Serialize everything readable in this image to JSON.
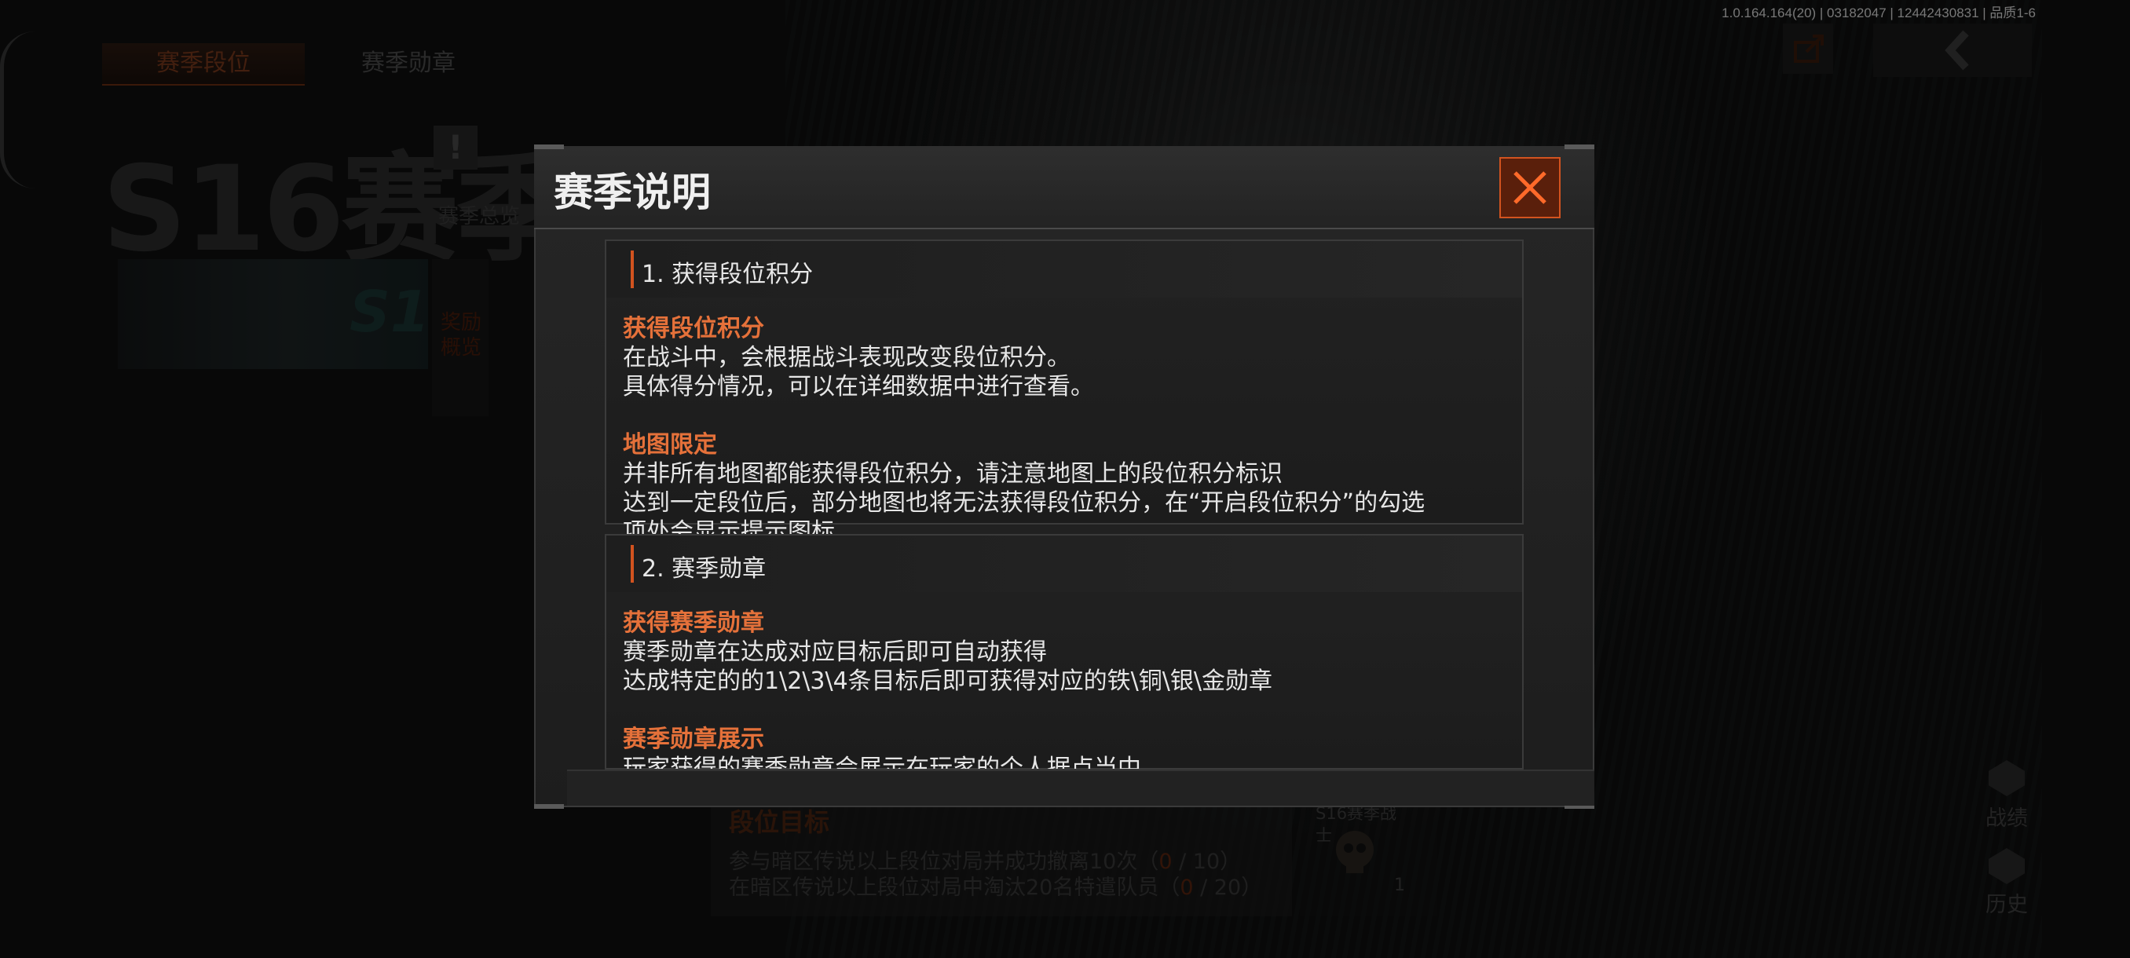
{
  "version_info": "1.0.164.164(20) | 03182047 | 12442430831 | 品质1-6",
  "background": {
    "tabs": [
      {
        "label": "赛季段位"
      },
      {
        "label": "赛季勋章"
      }
    ],
    "season_title": "S16赛季",
    "exclaim": "!",
    "season_overview": "赛季总览",
    "banner_text": "S16",
    "reward_overview": "奖励\n概览",
    "rank_goal": {
      "title": "段位目标",
      "lines": [
        {
          "text": "参与暗区传说以上段位对局并成功撤离10次（",
          "progress": "0",
          "total": " / 10）"
        },
        {
          "text": "在暗区传说以上段位对局中淘汰20名特遣队员（",
          "progress": "0",
          "total": " / 20）"
        }
      ]
    },
    "medal_label": "S16赛季战士",
    "medal_count": "1",
    "side": {
      "battle": "战绩",
      "history": "历史"
    }
  },
  "modal": {
    "title": "赛季说明",
    "sections": [
      {
        "title": "1. 获得段位积分",
        "blocks": [
          {
            "heading": "获得段位积分",
            "lines": [
              "在战斗中，会根据战斗表现改变段位积分。",
              "具体得分情况，可以在详细数据中进行查看。"
            ]
          },
          {
            "heading": "地图限定",
            "lines": [
              "并非所有地图都能获得段位积分，请注意地图上的段位积分标识",
              "达到一定段位后，部分地图也将无法获得段位积分，在“开启段位积分”的勾选",
              "项处会显示提示图标"
            ]
          }
        ]
      },
      {
        "title": "2. 赛季勋章",
        "blocks": [
          {
            "heading": "获得赛季勋章",
            "lines": [
              "赛季勋章在达成对应目标后即可自动获得",
              "达成特定的的1\\2\\3\\4条目标后即可获得对应的铁\\铜\\银\\金勋章"
            ]
          },
          {
            "heading": "赛季勋章展示",
            "lines": [
              "玩家获得的赛季勋章会展示在玩家的个人据点当中"
            ]
          }
        ]
      }
    ]
  },
  "colors": {
    "accent": "#e5713a",
    "close_border": "#d2531f",
    "modal_bg": "#232323"
  }
}
